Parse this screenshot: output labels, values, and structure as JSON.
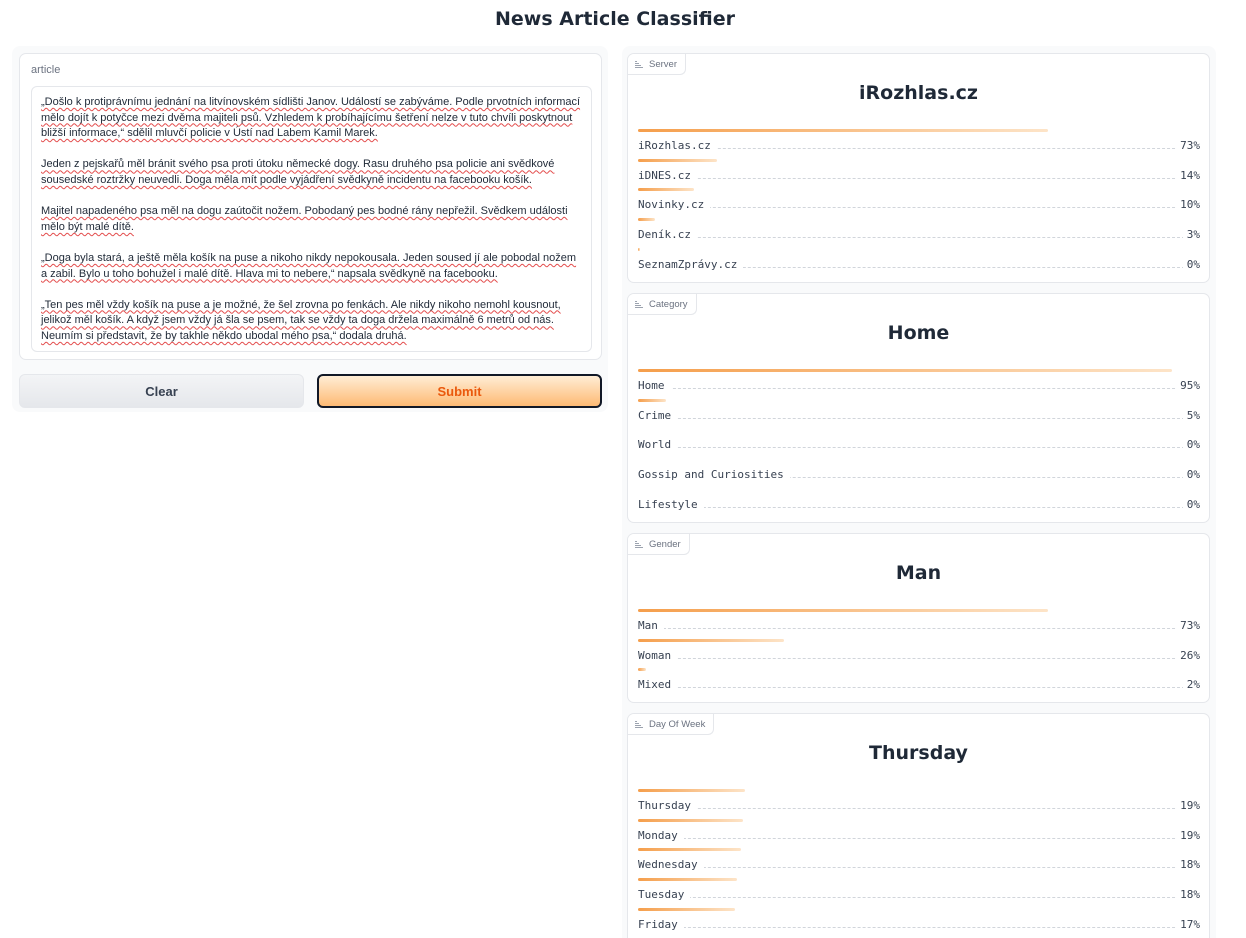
{
  "title": "News Article Classifier",
  "article": {
    "label": "article",
    "paragraphs": [
      "„Došlo k protiprávnímu jednání na litvínovském sídlišti Janov. Událostí se zabýváme. Podle prvotních informací mělo dojít k potyčce mezi dvěma majiteli psů. Vzhledem k probíhajícímu šetření nelze v tuto chvíli poskytnout bližší informace,“ sdělil mluvčí policie v Ústí nad Labem Kamil Marek.",
      "Jeden z pejskařů měl bránit svého psa proti útoku německé dogy. Rasu druhého psa policie ani svědkové sousedské roztržky neuvedli. Doga měla mít podle vyjádření svědkyně incidentu na facebooku košík.",
      "Majitel napadeného psa měl na dogu zaútočit nožem. Pobodaný pes bodné rány nepřežil. Svědkem události mělo být malé dítě.",
      "„Doga byla stará, a ještě měla košík na puse a nikoho nikdy nepokousala. Jeden soused jí ale pobodal nožem a zabil. Bylo u toho bohužel i malé dítě. Hlava mi to nebere,“ napsala svědkyně na facebooku.",
      "„Ten pes měl vždy košík na puse a je možné, že šel zrovna po fenkách. Ale nikdy nikoho nemohl kousnout, jelikož měl košík. A když jsem vždy já šla se psem, tak se vždy ta doga držela maximálně 6 metrů od nás. Neumím si představit, že by takhle někdo ubodal mého psa,“ dodala druhá."
    ]
  },
  "buttons": {
    "clear": "Clear",
    "submit": "Submit"
  },
  "colors": {
    "accent": "#f59e4b",
    "submit_text": "#ea580c"
  },
  "panels": [
    {
      "tag": "Server",
      "top_label": "iRozhlas.cz",
      "rows": [
        {
          "label": "iRozhlas.cz",
          "pct": "73%",
          "value": 0.73
        },
        {
          "label": "iDNES.cz",
          "pct": "14%",
          "value": 0.14
        },
        {
          "label": "Novinky.cz",
          "pct": "10%",
          "value": 0.1
        },
        {
          "label": "Deník.cz",
          "pct": "3%",
          "value": 0.03
        },
        {
          "label": "SeznamZprávy.cz",
          "pct": "0%",
          "value": 0.004
        }
      ]
    },
    {
      "tag": "Category",
      "top_label": "Home",
      "rows": [
        {
          "label": "Home",
          "pct": "95%",
          "value": 0.95
        },
        {
          "label": "Crime",
          "pct": "5%",
          "value": 0.05
        },
        {
          "label": "World",
          "pct": "0%",
          "value": 0.0
        },
        {
          "label": "Gossip and Curiosities",
          "pct": "0%",
          "value": 0.0
        },
        {
          "label": "Lifestyle",
          "pct": "0%",
          "value": 0.0
        }
      ]
    },
    {
      "tag": "Gender",
      "top_label": "Man",
      "rows": [
        {
          "label": "Man",
          "pct": "73%",
          "value": 0.73
        },
        {
          "label": "Woman",
          "pct": "26%",
          "value": 0.26
        },
        {
          "label": "Mixed",
          "pct": "2%",
          "value": 0.015
        }
      ]
    },
    {
      "tag": "Day Of Week",
      "top_label": "Thursday",
      "rows": [
        {
          "label": "Thursday",
          "pct": "19%",
          "value": 0.19
        },
        {
          "label": "Monday",
          "pct": "19%",
          "value": 0.187
        },
        {
          "label": "Wednesday",
          "pct": "18%",
          "value": 0.183
        },
        {
          "label": "Tuesday",
          "pct": "18%",
          "value": 0.176
        },
        {
          "label": "Friday",
          "pct": "17%",
          "value": 0.172
        }
      ]
    }
  ]
}
